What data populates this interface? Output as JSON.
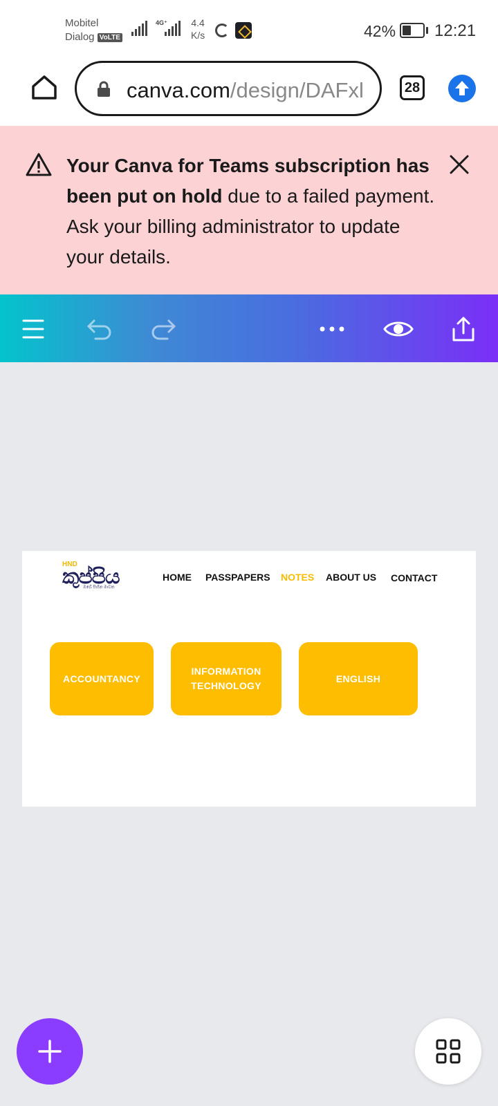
{
  "status_bar": {
    "carrier_1": "Mobitel",
    "carrier_2": "Dialog",
    "volte_badge": "VoLTE",
    "network_type": "4G⁺",
    "data_speed_value": "4.4",
    "data_speed_unit": "K/s",
    "battery_percent": "42%",
    "battery_level": 0.42,
    "time": "12:21"
  },
  "browser": {
    "url_domain": "canva.com",
    "url_path": "/design/DAFxl",
    "tab_count": "28"
  },
  "banner": {
    "bold_text": "Your Canva for Teams subscription has been put on hold",
    "rest_text": " due to a failed payment. Ask your billing administrator to update your details."
  },
  "design": {
    "logo": {
      "tag": "HND",
      "name": "කුප්පිය",
      "tagline": "ඔබේ සිහින මාවත"
    },
    "nav": {
      "home": "HOME",
      "passpapers": "PASSPAPERS",
      "notes": "NOTES",
      "about": "ABOUT US",
      "contact": "CONTACT"
    },
    "cards": {
      "accountancy": "ACCOUNTANCY",
      "it_line1": "INFORMATION",
      "it_line2": "TECHNOLOGY",
      "english": "ENGLISH"
    }
  },
  "colors": {
    "banner_bg": "#fdd2d5",
    "toolbar_start": "#03c4cc",
    "toolbar_end": "#7b2ff7",
    "card_yellow": "#ffbd00",
    "fab_purple": "#8b3dff",
    "browser_accent": "#1a73e8"
  },
  "icons": {
    "home": "home-icon",
    "lock": "lock-icon",
    "update": "arrow-up-circle-icon",
    "warning": "warning-triangle-icon",
    "close": "close-icon",
    "menu": "hamburger-menu-icon",
    "undo": "undo-icon",
    "redo": "redo-icon",
    "more": "more-horizontal-icon",
    "preview": "eye-icon",
    "share": "share-upload-icon",
    "add": "plus-icon",
    "pages": "grid-icon"
  }
}
